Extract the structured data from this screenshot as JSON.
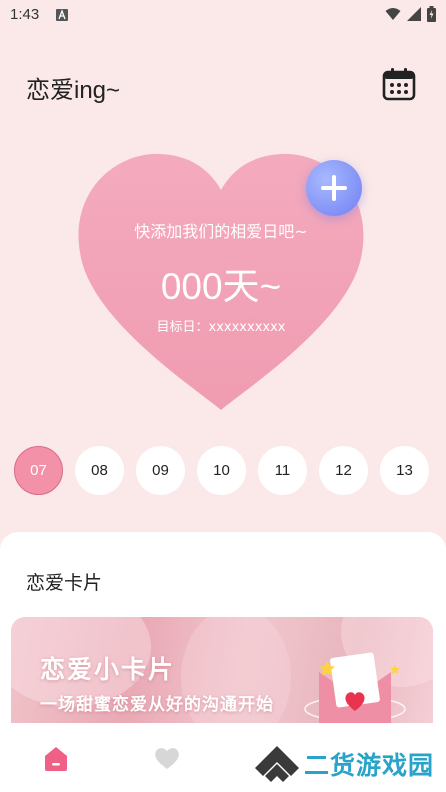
{
  "status_bar": {
    "time": "1:43"
  },
  "header": {
    "title": "恋爱ing~",
    "calendar_icon": "calendar-icon"
  },
  "heart_card": {
    "prompt": "快添加我们的相爱日吧~",
    "days": "000天~",
    "target_label": "目标日：xxxxxxxxxx",
    "add_icon": "plus-icon"
  },
  "dates": [
    "07",
    "08",
    "09",
    "10",
    "11",
    "12",
    "13"
  ],
  "selected_date": "07",
  "section": {
    "title": "恋爱卡片"
  },
  "feature_card": {
    "title": "恋爱小卡片",
    "subtitle": "一场甜蜜恋爱从好的沟通开始"
  },
  "bottom_nav": {
    "items": [
      "home-icon",
      "heart-icon"
    ]
  },
  "watermark": {
    "text": "二货游戏园"
  },
  "colors": {
    "background": "#fbe9e9",
    "heart": "#f2a3b6",
    "accent": "#f291a8",
    "add_button": "#7f8ef5",
    "brand": "#29a3c9"
  }
}
